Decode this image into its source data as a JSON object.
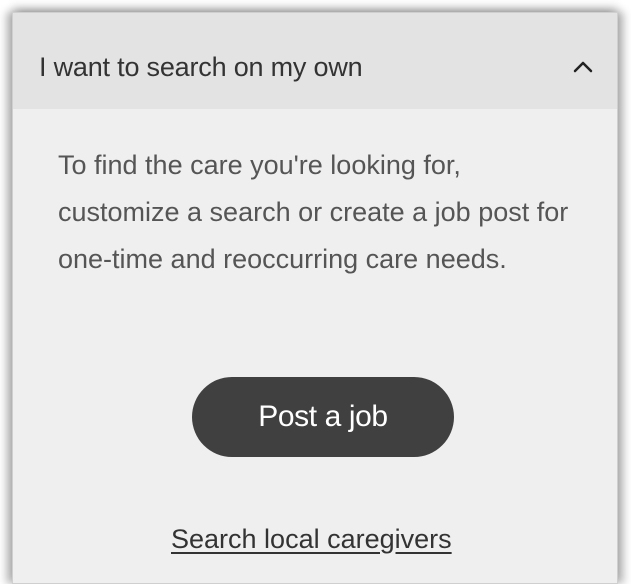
{
  "accordion": {
    "title": "I want to search on my own",
    "expanded": true,
    "toggle_icon": "chevron-up-icon",
    "body_text": "To find the care you're looking for, customize a search or create a job post for one-time and reoccurring care needs.",
    "primary_button_label": "Post a job",
    "link_label": "Search local caregivers"
  },
  "colors": {
    "header_bg": "#e3e3e3",
    "panel_bg": "#efefef",
    "button_bg": "#404040",
    "button_text": "#ffffff",
    "text": "#555555"
  }
}
